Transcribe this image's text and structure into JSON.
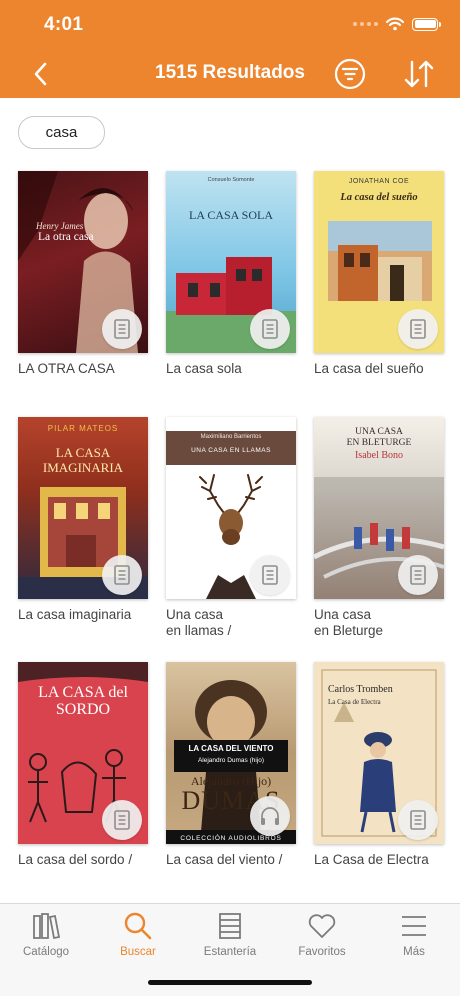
{
  "status_bar": {
    "time": "4:01"
  },
  "nav": {
    "title": "1515 Resultados"
  },
  "search_chip": {
    "label": "casa"
  },
  "covers": {
    "otra_casa": {
      "author": "Henry James",
      "title": "La otra casa"
    },
    "casa_sola": {
      "author": "Consuelo Somonte",
      "title": "LA CASA SOLA"
    },
    "casa_sueno": {
      "author": "JONATHAN COE",
      "title": "La casa del sueño"
    },
    "imaginaria": {
      "author": "PILAR MATEOS",
      "title": "LA CASA IMAGINARIA"
    },
    "llamas": {
      "author": "Maximiliano Barrientos",
      "title": "UNA CASA EN LLAMAS"
    },
    "bleturge": {
      "title_line1": "UNA CASA",
      "title_line2": "EN BLETURGE",
      "author": "Isabel Bono"
    },
    "sordo": {
      "title": "LA CASA del SORDO"
    },
    "viento": {
      "title": "LA CASA DEL VIENTO",
      "sub": "Alejandro Dumas (hijo)",
      "big_line1": "Alejandro (Hijo)",
      "big_line2": "DUMAS",
      "collection": "COLECCIÓN AUDIOLIBROS"
    },
    "electra": {
      "author": "Carlos Tromben",
      "title": "La Casa de Electra"
    }
  },
  "books": [
    {
      "title": "LA OTRA CASA",
      "icon": "document-icon"
    },
    {
      "title": "La casa sola",
      "icon": "document-icon"
    },
    {
      "title": "La casa del sueño",
      "icon": "document-icon"
    },
    {
      "title": "La casa imaginaria",
      "icon": "document-icon"
    },
    {
      "title": "Una casa\nen llamas /",
      "icon": "document-icon"
    },
    {
      "title": "Una casa\nen Bleturge",
      "icon": "document-icon"
    },
    {
      "title": "La casa del sordo /",
      "icon": "document-icon"
    },
    {
      "title": "La casa del viento /",
      "icon": "headphones-icon"
    },
    {
      "title": "La Casa de Electra",
      "icon": "document-icon"
    }
  ],
  "tabs": [
    {
      "label": "Catálogo",
      "icon": "books-icon",
      "active": false
    },
    {
      "label": "Buscar",
      "icon": "search-icon",
      "active": true
    },
    {
      "label": "Estantería",
      "icon": "shelf-icon",
      "active": false
    },
    {
      "label": "Favoritos",
      "icon": "heart-icon",
      "active": false
    },
    {
      "label": "Más",
      "icon": "menu-icon",
      "active": false
    }
  ],
  "colors": {
    "accent": "#EC852D",
    "tab_inactive": "#7b7b7b"
  }
}
